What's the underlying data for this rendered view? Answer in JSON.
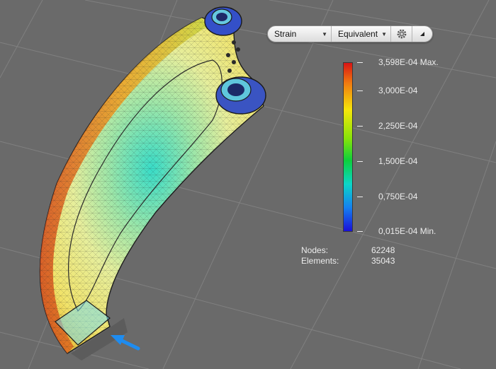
{
  "toolbar": {
    "result_type": "Strain",
    "component": "Equivalent",
    "settings_icon": "gear-icon",
    "collapse_icon": "triangle-collapse-icon"
  },
  "legend": {
    "max_label": "3,598E-04 Max.",
    "ticks": [
      "3,000E-04",
      "2,250E-04",
      "1,500E-04",
      "0,750E-04"
    ],
    "min_label": "0,015E-04 Min.",
    "colors": [
      "#d81414",
      "#f07a10",
      "#f5e60a",
      "#86e30a",
      "#0ccf3c",
      "#0cd6c7",
      "#1580f0",
      "#1a10d8"
    ]
  },
  "stats": {
    "nodes_label": "Nodes:",
    "nodes_value": "62248",
    "elements_label": "Elements:",
    "elements_value": "35043"
  },
  "colors": {
    "background": "#6a6a6a",
    "grid": "#808080",
    "text": "#ececec"
  }
}
